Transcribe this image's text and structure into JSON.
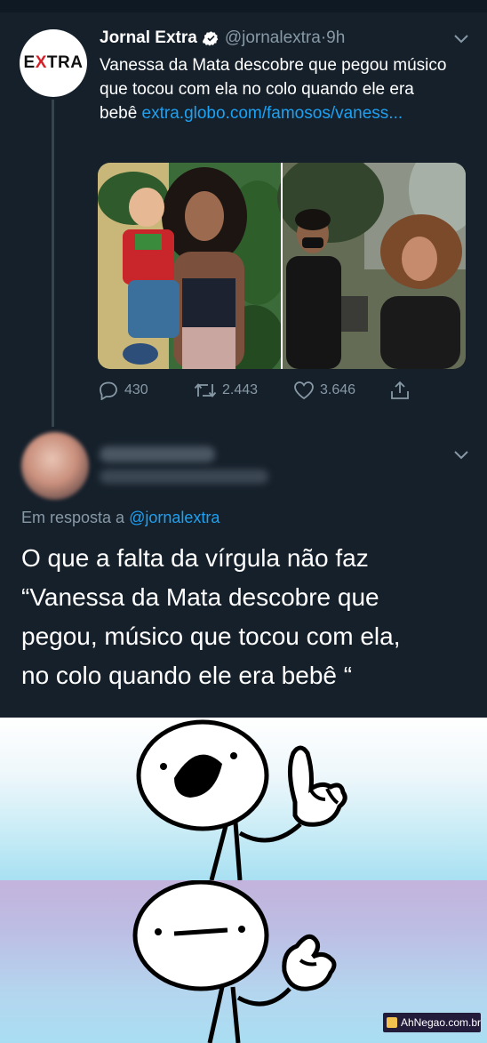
{
  "tweet": {
    "author_name": "Jornal Extra",
    "author_handle": "@jornalextra",
    "separator": "·",
    "time": "9h",
    "avatar_logo": {
      "left": "E",
      "mid": "X",
      "right": "TRA"
    },
    "text": "Vanessa da Mata descobre que pegou músico que tocou com ela no colo quando ele era bebê ",
    "link": "extra.globo.com/famosos/vaness...",
    "replies": "430",
    "retweets": "2.443",
    "likes": "3.646"
  },
  "reply": {
    "replying_prefix": "Em resposta a ",
    "replying_handle": "@jornalextra",
    "text_line1": "O que a falta da vírgula não faz",
    "text_line2": "“Vanessa da Mata descobre que",
    "text_line3": "pegou, músico que tocou com ela,",
    "text_line4": "no colo quando ele era bebê “"
  },
  "watermark": "AhNegao.com.br",
  "colors": {
    "background": "#15202b",
    "link": "#1da1f2",
    "muted": "#8899a6",
    "extra_red": "#d61f26"
  }
}
